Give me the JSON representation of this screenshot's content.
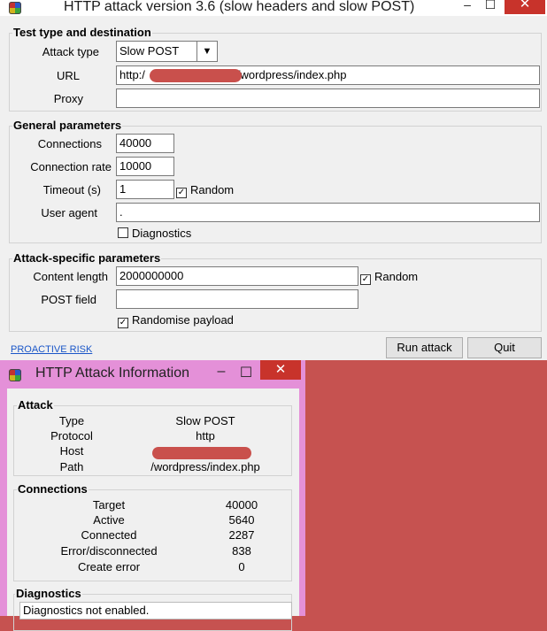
{
  "main_window": {
    "title": "HTTP attack version 3.6 (slow headers and slow POST)",
    "minimize": "–",
    "maximize": "☐",
    "close": "✕",
    "test_group": {
      "legend": "Test type and destination",
      "attack_type_label": "Attack type",
      "attack_type_value": "Slow POST",
      "url_label": "URL",
      "url_prefix": "http:/",
      "url_suffix": "/wordpress/index.php",
      "proxy_label": "Proxy",
      "proxy_value": ""
    },
    "general_group": {
      "legend": "General parameters",
      "connections_label": "Connections",
      "connections_value": "40000",
      "rate_label": "Connection rate",
      "rate_value": "10000",
      "timeout_label": "Timeout (s)",
      "timeout_value": "1",
      "random_label": "Random",
      "user_agent_label": "User agent",
      "user_agent_value": ".",
      "diagnostics_label": "Diagnostics"
    },
    "specific_group": {
      "legend": "Attack-specific parameters",
      "content_length_label": "Content length",
      "content_length_value": "2000000000",
      "random_label": "Random",
      "post_field_label": "POST field",
      "post_field_value": "",
      "randomise_label": "Randomise payload"
    },
    "link": "PROACTIVE RISK",
    "run_button": "Run attack",
    "quit_button": "Quit"
  },
  "info_window": {
    "title": "HTTP Attack Information",
    "minimize": "–",
    "maximize": "☐",
    "close": "✕",
    "attack": {
      "legend": "Attack",
      "type_label": "Type",
      "type_value": "Slow POST",
      "protocol_label": "Protocol",
      "protocol_value": "http",
      "host_label": "Host",
      "path_label": "Path",
      "path_value": "/wordpress/index.php"
    },
    "connections": {
      "legend": "Connections",
      "rows": [
        {
          "label": "Target",
          "value": "40000"
        },
        {
          "label": "Active",
          "value": "5640"
        },
        {
          "label": "Connected",
          "value": "2287"
        },
        {
          "label": "Error/disconnected",
          "value": "838"
        },
        {
          "label": "Create error",
          "value": "0"
        }
      ]
    },
    "diagnostics": {
      "legend": "Diagnostics",
      "text": "Diagnostics not enabled."
    }
  },
  "colors": {
    "background_red": "#c65250",
    "redaction": "#c9504c",
    "info_frame": "#e490d8",
    "close_red": "#c8332b"
  }
}
